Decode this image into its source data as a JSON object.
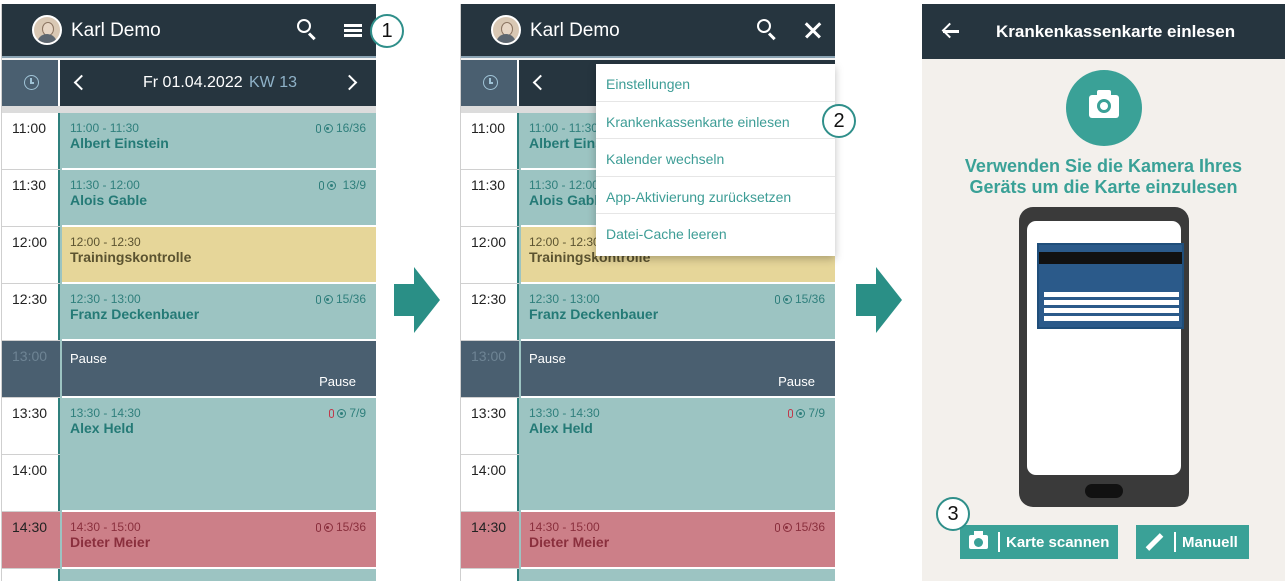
{
  "colors": {
    "teal": "#3aa197",
    "dark_header": "#26353f",
    "slate": "#4a5f70",
    "appt_teal": "#9cc4c2",
    "appt_yellow": "#e6d699",
    "appt_red": "#cc7f88"
  },
  "header": {
    "user_name": "Karl Demo",
    "search_icon": "search-icon",
    "menu_icon": "hamburger-menu-icon",
    "close_icon": "close-icon"
  },
  "nav": {
    "date": "Fr 01.04.2022",
    "week": "KW 13"
  },
  "times": [
    "11:00",
    "11:30",
    "12:00",
    "12:30",
    "13:00",
    "13:30",
    "14:00",
    "14:30"
  ],
  "appointments": [
    {
      "time": "11:00 - 11:30",
      "name": "Albert Einstein",
      "count": "16/36"
    },
    {
      "time": "11:30 - 12:00",
      "name": "Alois Gable",
      "count": "13/9"
    },
    {
      "time": "12:00 - 12:30",
      "name": "Trainingskontrolle"
    },
    {
      "time": "12:30 - 13:00",
      "name": "Franz Deckenbauer",
      "count": "15/36"
    },
    {
      "left": "Pause",
      "right": "Pause"
    },
    {
      "time": "13:30 - 14:30",
      "name": "Alex Held",
      "count": "7/9"
    },
    {
      "time": "14:30 - 15:00",
      "name": "Dieter Meier",
      "count": "15/36"
    }
  ],
  "menu": {
    "items": [
      "Einstellungen",
      "Krankenkassenkarte einlesen",
      "Kalender wechseln",
      "App-Aktivierung zurücksetzen",
      "Datei-Cache leeren"
    ]
  },
  "scan_screen": {
    "title": "Krankenkassenkarte einlesen",
    "message_line1": "Verwenden Sie die Kamera Ihres",
    "message_line2": "Geräts um die Karte einzulesen",
    "scan_button": "Karte scannen",
    "manual_button": "Manuell"
  },
  "callouts": [
    "1",
    "2",
    "3"
  ]
}
